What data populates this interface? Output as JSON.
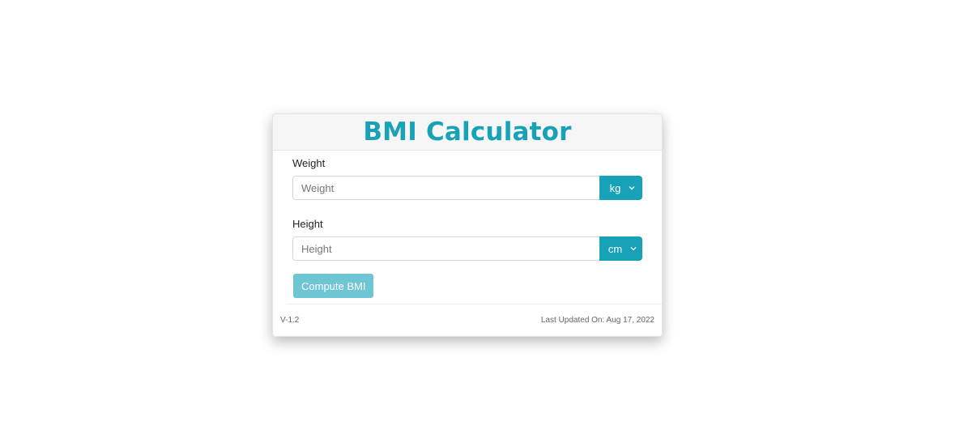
{
  "header": {
    "title": "BMI Calculator"
  },
  "weight": {
    "label": "Weight",
    "placeholder": "Weight",
    "unit": "kg",
    "unit_icon": "chevron-down-icon"
  },
  "height": {
    "label": "Height",
    "placeholder": "Height",
    "unit": "cm",
    "unit_icon": "chevron-down-icon"
  },
  "actions": {
    "compute_label": "Compute BMI"
  },
  "footer": {
    "version": "V-1.2",
    "last_updated": "Last Updated On: Aug 17, 2022"
  },
  "colors": {
    "accent": "#17a2b8",
    "button_disabled": "#6ec6d4",
    "header_bg": "#f6f6f6"
  }
}
